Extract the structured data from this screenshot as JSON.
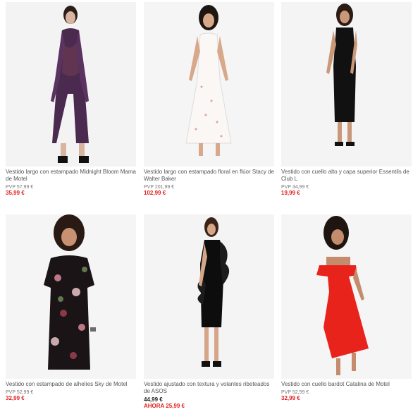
{
  "products": [
    {
      "title": "Vestido largo con estampado Midnight Bloom Mama de Motel",
      "pvp": "PVP 57,99 €",
      "price": "35,99 €",
      "icon": "purple-printed-maxi-dress-photo"
    },
    {
      "title": "Vestido largo con estampado floral en flúor Stacy de Walter Baker",
      "pvp": "PVP 201,99 €",
      "price": "102,99 €",
      "icon": "white-floral-maxi-dress-photo"
    },
    {
      "title": "Vestido con cuello alto y capa superior Essentils de Club L",
      "pvp": "PVP 34,99 €",
      "price": "19,99 €",
      "icon": "black-midi-dress-photo"
    },
    {
      "title": "Vestido con estampado de alhelíes Sky de Motel",
      "pvp": "PVP 52,99 €",
      "price": "32,99 €",
      "icon": "floral-tea-dress-photo"
    },
    {
      "title": "Vestido ajustado con textura y volantes ribeteados de ASOS",
      "price_black": "44,99 €",
      "price": "AHORA 25,99 €",
      "icon": "black-ruffle-bodycon-dress-photo"
    },
    {
      "title": "Vestido con cuello bardot Catalina de Motel",
      "pvp": "PVP 52,99 €",
      "price": "32,99 €",
      "icon": "red-bardot-dress-photo"
    }
  ],
  "colors": {
    "sale_price": "#e02020",
    "text": "#555555"
  }
}
